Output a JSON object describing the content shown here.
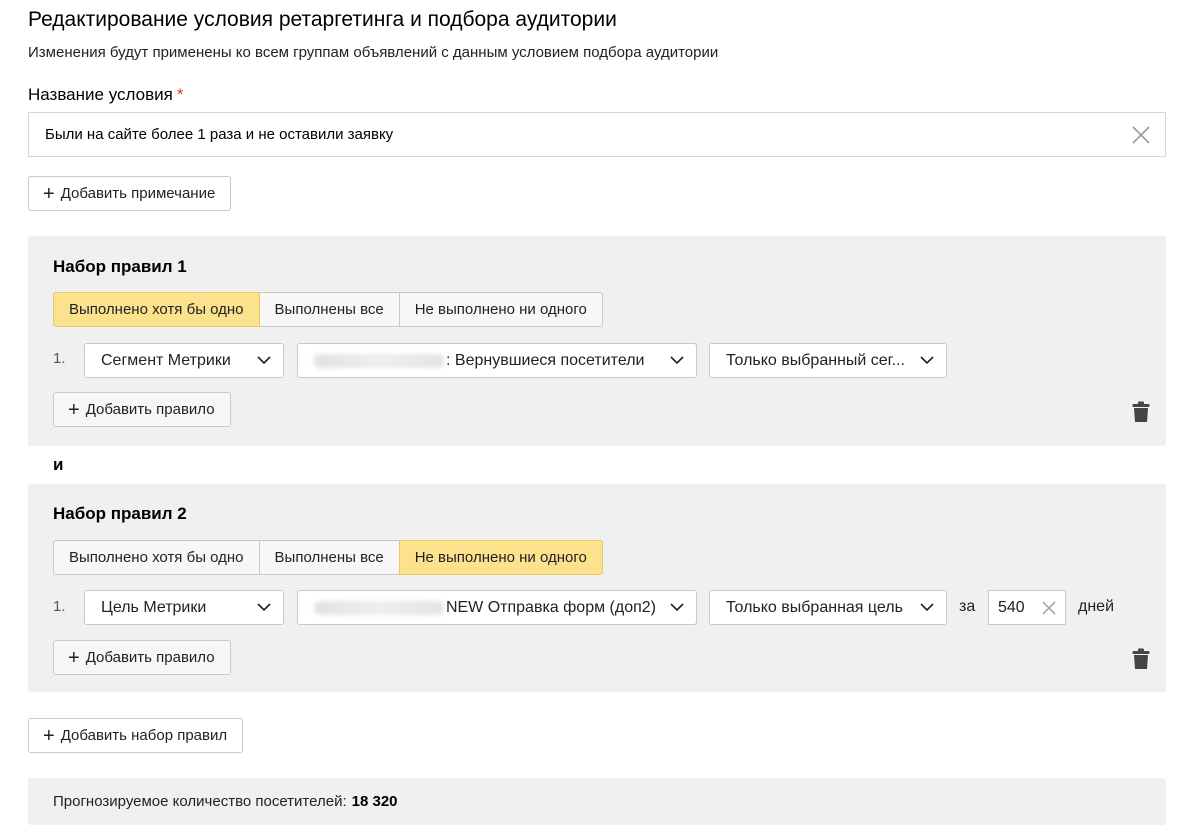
{
  "header": {
    "title": "Редактирование условия ретаргетинга и подбора аудитории",
    "subtitle": "Изменения будут применены ко всем группам объявлений с данным условием подбора аудитории"
  },
  "condition_name": {
    "label": "Название условия",
    "required_mark": "*",
    "value": "Были на сайте более 1 раза и не оставили заявку"
  },
  "add_note_label": "Добавить примечание",
  "plus_glyph": "+",
  "rulesets": [
    {
      "title": "Набор правил 1",
      "modes": [
        "Выполнено хотя бы одно",
        "Выполнены все",
        "Не выполнено ни одного"
      ],
      "active_mode": "Выполнено хотя бы одно",
      "rules": [
        {
          "number": "1.",
          "type": "Сегмент Метрики",
          "target_suffix": ": Вернувшиеся посетители",
          "scope": "Только выбранный сег..."
        }
      ],
      "add_rule_label": "Добавить правило"
    },
    {
      "title": "Набор правил 2",
      "modes": [
        "Выполнено хотя бы одно",
        "Выполнены все",
        "Не выполнено ни одного"
      ],
      "active_mode": "Не выполнено ни одного",
      "rules": [
        {
          "number": "1.",
          "type": "Цель Метрики",
          "target_suffix": "NEW Отправка форм (доп2)",
          "scope": "Только выбранная цель",
          "period_prefix": "за",
          "period_value": "540",
          "period_suffix": "дней"
        }
      ],
      "add_rule_label": "Добавить правило"
    }
  ],
  "and_label": "и",
  "add_ruleset_label": "Добавить набор правил",
  "forecast": {
    "label": "Прогнозируемое количество посетителей:",
    "value": "18 320"
  },
  "colors": {
    "active_mode_bg": "#fde28e",
    "panel_bg": "#f0f0f0",
    "required": "#e0372c"
  },
  "icons": {
    "clear": "close-icon",
    "dropdown": "chevron-down-icon",
    "delete": "trash-icon",
    "add": "plus-icon"
  }
}
